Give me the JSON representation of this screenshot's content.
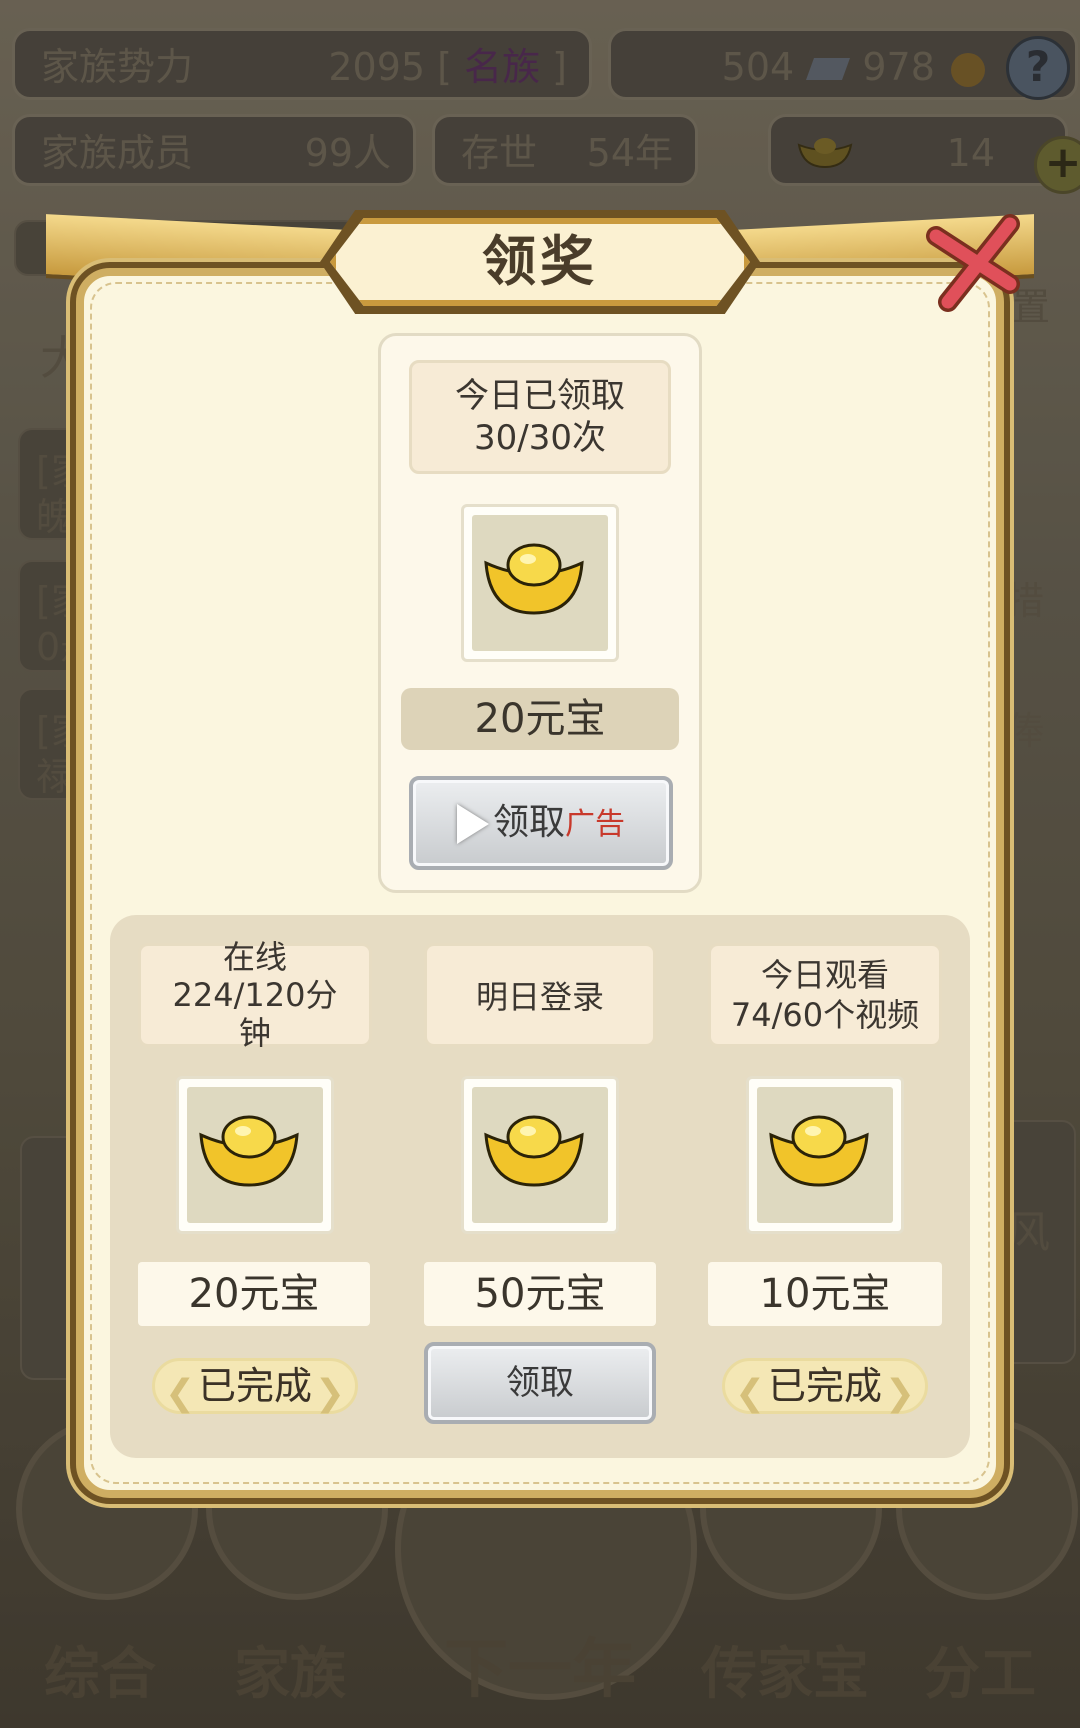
{
  "background": {
    "family_power_label": "家族势力",
    "family_power_value": "2095",
    "family_power_rank": "名族",
    "silver": "504",
    "coins": "978",
    "help": "?",
    "members_label": "家族成员",
    "members_value": "99人",
    "existence_label": "存世",
    "existence_value": "54年",
    "gold_ingots": "14",
    "plus": "+",
    "partial_row": "大",
    "side_left": [
      "[家",
      "[家",
      "[家"
    ],
    "side_left_second": [
      "魄",
      "0悬",
      "禄"
    ],
    "side_right": [
      "措",
      "俸"
    ],
    "settings_partial": "置",
    "wind": "风",
    "nav": [
      "综合",
      "家族",
      "下一年",
      "传家宝",
      "分工"
    ]
  },
  "modal": {
    "title": "领奖",
    "ad_reward": {
      "status_line1": "今日已领取",
      "status_line2": "30/30次",
      "icon": "gold-ingot-icon",
      "amount": "20元宝",
      "button_label": "领取",
      "button_tag": "广告"
    },
    "tasks": [
      {
        "title": "在线\n224/120分\n钟",
        "icon": "gold-ingot-icon",
        "amount": "20元宝",
        "button": "已完成",
        "state": "completed"
      },
      {
        "title": "明日登录",
        "icon": "gold-ingot-icon",
        "amount": "50元宝",
        "button": "领取",
        "state": "claimable"
      },
      {
        "title": "今日观看\n74/60个视频",
        "icon": "gold-ingot-icon",
        "amount": "10元宝",
        "button": "已完成",
        "state": "completed"
      }
    ]
  },
  "colors": {
    "modal_bg": "#fbf6df",
    "frame_gold": "#cfae62",
    "tag_red": "#c8392b",
    "close_red": "#e0505a"
  }
}
